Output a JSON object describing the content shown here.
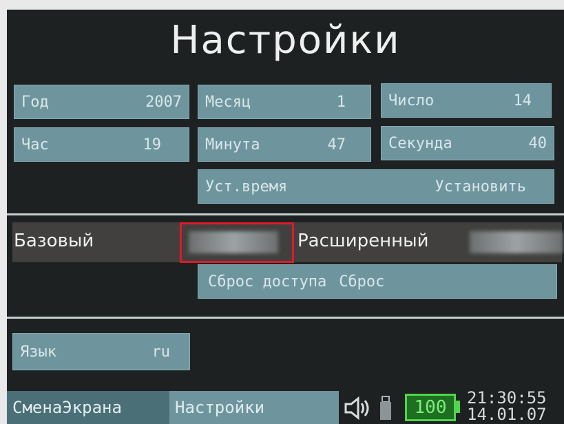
{
  "title": "Настройки",
  "datetime": {
    "year": {
      "label": "Год",
      "value": "2007"
    },
    "month": {
      "label": "Месяц",
      "value": "1"
    },
    "day": {
      "label": "Число",
      "value": "14"
    },
    "hour": {
      "label": "Час",
      "value": "19"
    },
    "minute": {
      "label": "Минута",
      "value": "47"
    },
    "second": {
      "label": "Секунда",
      "value": "40"
    },
    "set_time": {
      "label": "Уст.время",
      "action": "Установить"
    }
  },
  "access": {
    "basic_label": "Базовый",
    "advanced_label": "Расширенный",
    "reset": {
      "label": "Сброс доступа",
      "action": "Сброс"
    }
  },
  "language": {
    "label": "Язык",
    "value": "ru"
  },
  "statusbar": {
    "tab_switch": "СменаЭкрана",
    "tab_settings": "Настройки",
    "battery_level": "100",
    "time": "21:30:55",
    "date": "14.01.07"
  },
  "colors": {
    "field_bg": "#6e959e",
    "screen_bg": "#1e2122",
    "highlight": "#e0192a",
    "battery": "#4fd64c"
  },
  "icons": [
    "speaker-icon",
    "usb-icon",
    "battery-icon"
  ]
}
